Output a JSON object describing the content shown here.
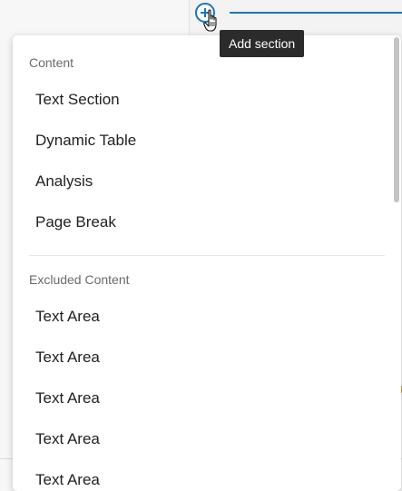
{
  "tooltip": {
    "text": "Add section"
  },
  "add_button": {
    "icon": "plus-circle-icon",
    "color": "#1a76b8"
  },
  "cursor": {
    "icon": "hand-pointer-icon"
  },
  "menu": {
    "sections": [
      {
        "title": "Content",
        "items": [
          "Text Section",
          "Dynamic Table",
          "Analysis",
          "Page Break"
        ]
      },
      {
        "title": "Excluded Content",
        "items": [
          "Text Area",
          "Text Area",
          "Text Area",
          "Text Area",
          "Text Area"
        ]
      }
    ]
  },
  "colors": {
    "accent": "#1a76b8",
    "tooltip_bg": "#2b2b2b",
    "section_title": "#6b6b6b",
    "item_text": "#222222"
  }
}
